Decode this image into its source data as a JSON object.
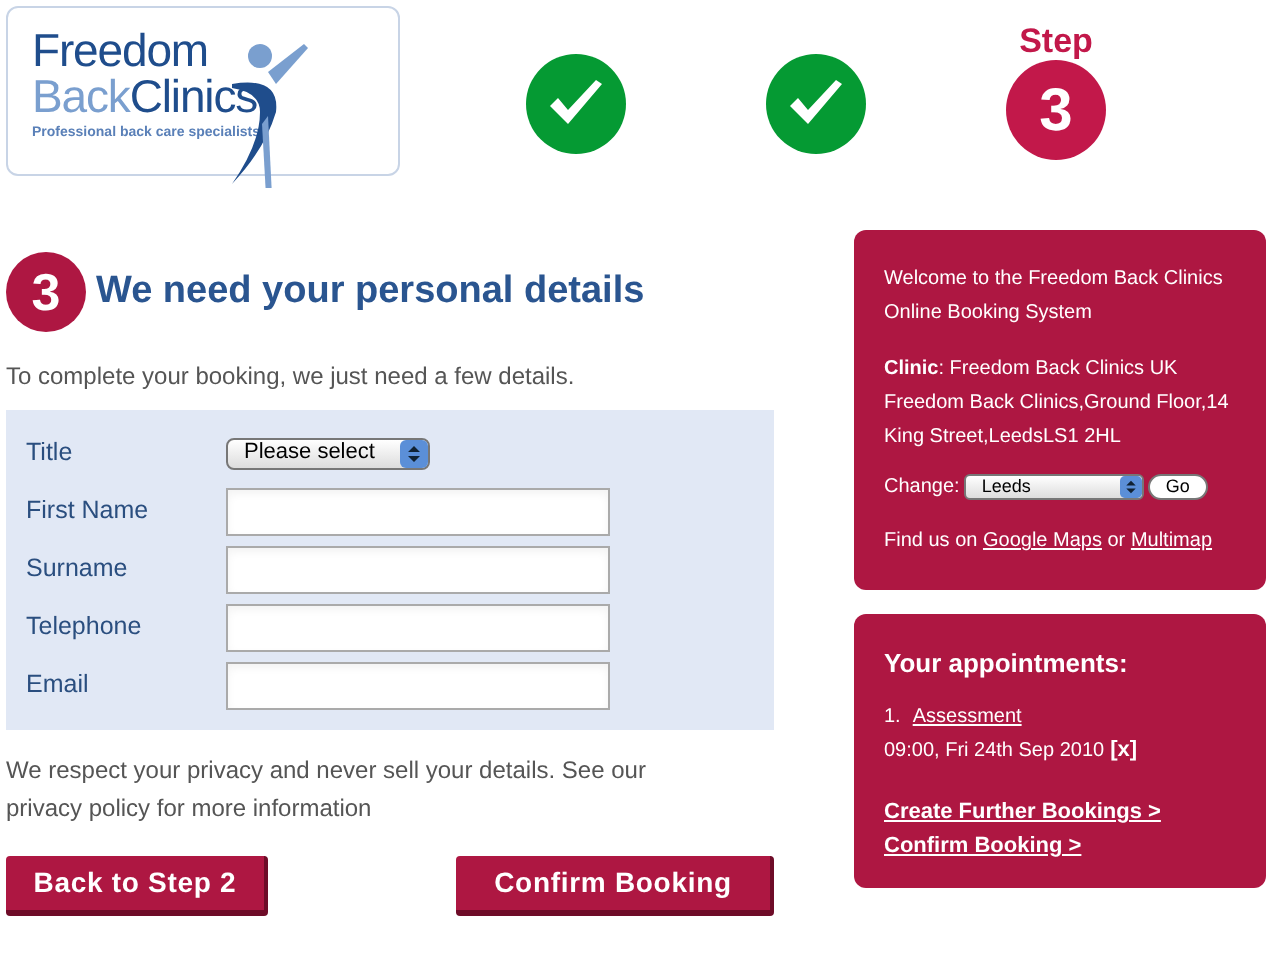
{
  "logo": {
    "line_1": "Freedom",
    "line_2a": "Back",
    "line_2b": "Clinics",
    "tagline": "Professional back care specialists"
  },
  "steps": [
    {
      "kind": "done"
    },
    {
      "kind": "done"
    },
    {
      "kind": "current",
      "label": "Step",
      "number": "3"
    }
  ],
  "heading": {
    "number": "3",
    "title": "We need your personal details"
  },
  "intro": "To complete your booking, we just need a few details.",
  "fields": [
    {
      "kind": "select",
      "label": "Title",
      "value": "Please select"
    },
    {
      "kind": "text",
      "label": "First Name"
    },
    {
      "kind": "text",
      "label": "Surname"
    },
    {
      "kind": "text",
      "label": "Telephone"
    },
    {
      "kind": "text",
      "label": "Email"
    }
  ],
  "privacy": "We respect your privacy and never sell your details. See our privacy policy for more information",
  "buttons": [
    "Back to Step 2",
    "Confirm Booking"
  ],
  "sidebar": {
    "welcome": "Welcome to the Freedom Back Clinics Online Booking System",
    "clinic": "**Clinic**: Freedom Back Clinics UK",
    "address": "Freedom Back Clinics,Ground Floor,14 King Street,LeedsLS1 2HL",
    "change_label": "Change:",
    "change_value": "Leeds",
    "go": "Go",
    "find_prefix": "Find us on",
    "find_link_1": "Google Maps",
    "find_join": "or",
    "find_link_2": "Multimap"
  },
  "appointments": {
    "title": "Your appointments:",
    "items": [
      {
        "number": "1.",
        "name": "Assessment",
        "time": "09:00, Fri 24th Sep 2010",
        "remove": "[x]"
      }
    ],
    "links": [
      "Create Further Bookings >",
      "Confirm Booking >"
    ]
  }
}
